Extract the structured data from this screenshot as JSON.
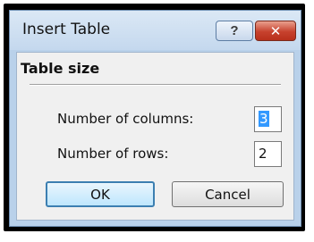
{
  "dialog": {
    "title": "Insert Table",
    "help_glyph": "?",
    "close_glyph": "✕"
  },
  "table_size": {
    "heading": "Table size",
    "columns_label": "Number of columns:",
    "columns_value": "3",
    "rows_label": "Number of rows:",
    "rows_value": "2"
  },
  "buttons": {
    "ok": "OK",
    "cancel": "Cancel"
  },
  "colors": {
    "titlebar": "#c4d8ee",
    "close_button": "#c7412d",
    "selection": "#3399ff"
  }
}
